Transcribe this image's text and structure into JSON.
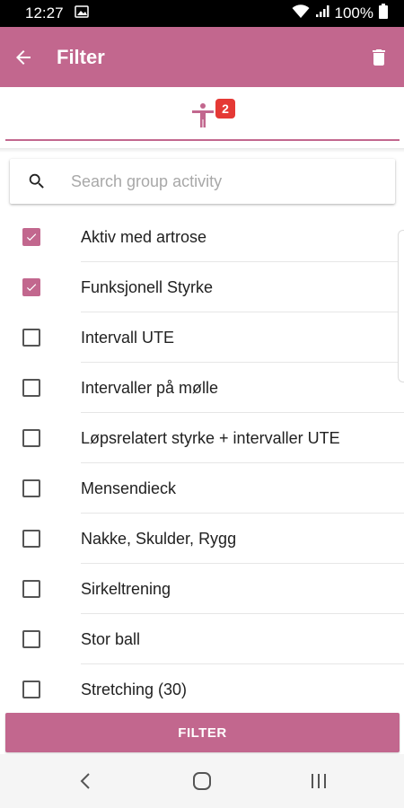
{
  "status_bar": {
    "time": "12:27",
    "battery": "100%"
  },
  "app_bar": {
    "title": "Filter",
    "back_icon": "arrow-left-icon",
    "delete_icon": "trash-icon",
    "background": "#c2678e"
  },
  "tabs": {
    "active_icon": "person-activity-icon",
    "badge_count": "2",
    "badge_color": "#e53935"
  },
  "search": {
    "placeholder": "Search group activity",
    "value": ""
  },
  "activities": [
    {
      "label": "Aktiv med artrose",
      "checked": true
    },
    {
      "label": "Funksjonell Styrke",
      "checked": true
    },
    {
      "label": "Intervall UTE",
      "checked": false
    },
    {
      "label": "Intervaller på mølle",
      "checked": false
    },
    {
      "label": "Løpsrelatert styrke + intervaller UTE",
      "checked": false
    },
    {
      "label": "Mensendieck",
      "checked": false
    },
    {
      "label": "Nakke, Skulder, Rygg",
      "checked": false
    },
    {
      "label": "Sirkeltrening",
      "checked": false
    },
    {
      "label": "Stor ball",
      "checked": false
    },
    {
      "label": "Stretching (30)",
      "checked": false
    }
  ],
  "filter_button": {
    "label": "FILTER"
  },
  "accent_color": "#c2678e"
}
